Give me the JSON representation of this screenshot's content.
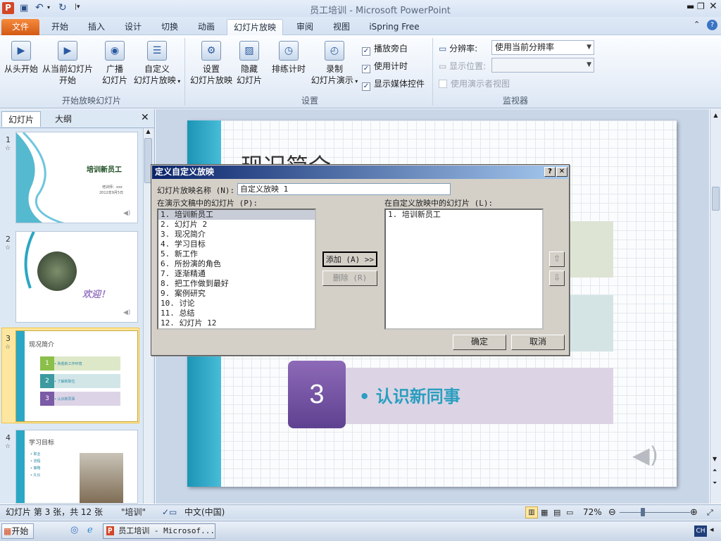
{
  "window": {
    "title": "员工培训 - Microsoft PowerPoint"
  },
  "tabs": {
    "file": "文件",
    "home": "开始",
    "insert": "插入",
    "design": "设计",
    "transitions": "切换",
    "animations": "动画",
    "slideshow": "幻灯片放映",
    "review": "审阅",
    "view": "视图",
    "ispring": "iSpring Free"
  },
  "ribbon": {
    "start": {
      "from_beginning": "从头开始",
      "from_current_1": "从当前幻灯片",
      "from_current_2": "开始",
      "broadcast_1": "广播",
      "broadcast_2": "幻灯片",
      "custom_1": "自定义",
      "custom_2": "幻灯片放映",
      "group": "开始放映幻灯片"
    },
    "setup": {
      "setup_1": "设置",
      "setup_2": "幻灯片放映",
      "hide_1": "隐藏",
      "hide_2": "幻灯片",
      "rehearse": "排练计时",
      "record_1": "录制",
      "record_2": "幻灯片演示",
      "play_narration": "播放旁白",
      "use_timings": "使用计时",
      "show_media": "显示媒体控件",
      "group": "设置"
    },
    "monitors": {
      "resolution_label": "分辨率:",
      "resolution_value": "使用当前分辨率",
      "show_on_label": "显示位置:",
      "presenter_view": "使用演示者视图",
      "group": "监视器"
    }
  },
  "leftpane": {
    "tab_slides": "幻灯片",
    "tab_outline": "大纲"
  },
  "thumbs": {
    "t1": {
      "num": "1",
      "star": "☆",
      "title": "培训新员工",
      "sub1": "培训师：xxx",
      "sub2": "2012年9月5日"
    },
    "t2": {
      "num": "2",
      "star": "☆",
      "text": "欢迎！"
    },
    "t3": {
      "num": "3",
      "star": "☆",
      "title": "现况简介",
      "item1": "• 熟悉新工作环境",
      "item2": "• 了解新职位",
      "item3": "• 认识新同事"
    },
    "t4": {
      "num": "4",
      "star": "☆",
      "title": "学习目标",
      "b1": "• 职业",
      "b2": "• 流程",
      "b3": "• 策略",
      "b4": "• 礼仪"
    }
  },
  "slide": {
    "title": "现况简介",
    "item3_num": "3",
    "item3_text": "• 认识新同事"
  },
  "dialog": {
    "title": "定义自定义放映",
    "name_label": "幻灯片放映名称 (N):",
    "name_value": "自定义放映 1",
    "left_label": "在演示文稿中的幻灯片 (P):",
    "right_label": "在自定义放映中的幻灯片 (L):",
    "left_items": [
      "1. 培训新员工",
      "2. 幻灯片 2",
      "3. 现况简介",
      "4. 学习目标",
      "5. 新工作",
      "6. 所扮演的角色",
      "7. 逐渐精通",
      "8. 把工作做到最好",
      "9. 案例研究",
      "10. 讨论",
      "11. 总结",
      "12. 幻灯片 12"
    ],
    "right_items": [
      "1. 培训新员工"
    ],
    "add_button": "添加 (A) >>",
    "remove_button": "删除 (R)",
    "ok_button": "确定",
    "cancel_button": "取消"
  },
  "status": {
    "slide_info": "幻灯片 第 3 张，共 12 张",
    "theme": "\"培训\"",
    "language": "中文(中国)",
    "zoom": "72%"
  },
  "taskbar": {
    "start": "开始",
    "app": "员工培训 - Microsof...",
    "ime": "CH"
  },
  "colors": {
    "accent_purple": "#7b5aa6",
    "accent_teal": "#2aa7c4",
    "selected_thumb": "#f3c33c",
    "dialog_title": "#0a246a"
  }
}
